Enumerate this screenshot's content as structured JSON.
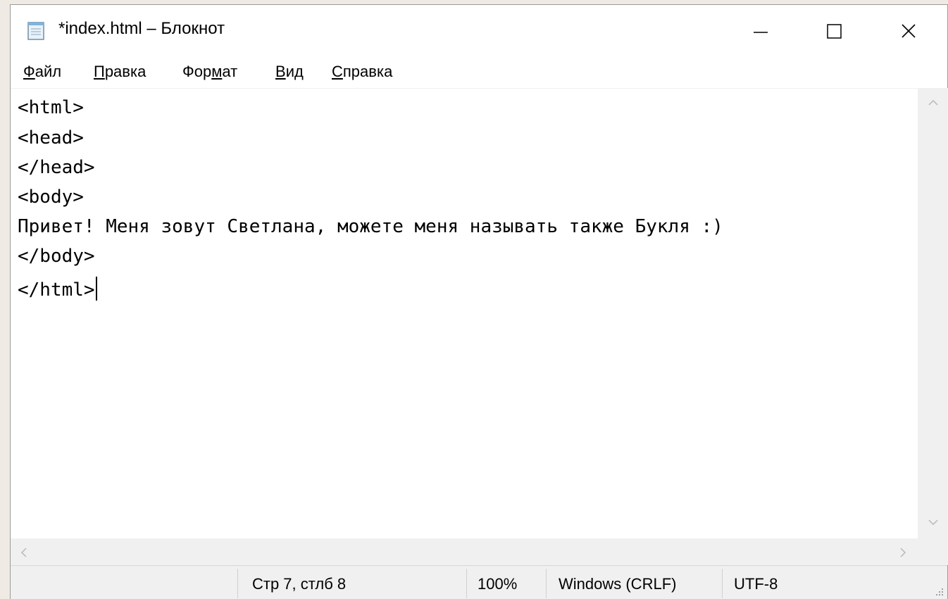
{
  "window": {
    "title": "*index.html – Блокнот",
    "icon": "notepad-icon",
    "controls": [
      "minimize-icon",
      "maximize-icon",
      "close-icon"
    ]
  },
  "menu": {
    "items": [
      {
        "pre": "",
        "u": "Ф",
        "post": "айл"
      },
      {
        "pre": "",
        "u": "П",
        "post": "равка"
      },
      {
        "pre": "Фор",
        "u": "м",
        "post": "ат"
      },
      {
        "pre": "",
        "u": "В",
        "post": "ид"
      },
      {
        "pre": "",
        "u": "С",
        "post": "правка"
      }
    ]
  },
  "editor": {
    "lines": [
      "<html>",
      "<head>",
      "</head>",
      "<body>",
      "Привет! Меня зовут Светлана, можете меня называть также Букля :)",
      "</body>",
      "</html>"
    ]
  },
  "status": {
    "position": "Стр 7, стлб 8",
    "zoom": "100%",
    "line_endings": "Windows (CRLF)",
    "encoding": "UTF-8"
  },
  "colors": {
    "page_background": "#efebe4",
    "chrome": "#f0f0f0",
    "text": "#000000"
  }
}
